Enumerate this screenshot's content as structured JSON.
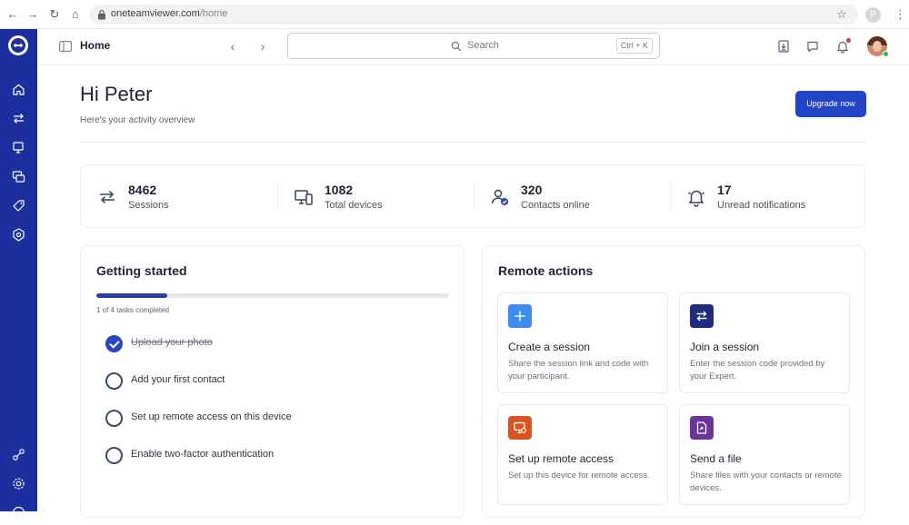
{
  "browser": {
    "url_host": "oneteamviewer.com",
    "url_path": "/home",
    "profile_initial": "P"
  },
  "header": {
    "title": "Home",
    "search_placeholder": "Search",
    "search_shortcut": "Ctrl + K"
  },
  "main": {
    "greeting": "Hi Peter",
    "subtitle": "Here's your activity overview",
    "upgrade_label": "Upgrade now"
  },
  "stats": [
    {
      "value": "8462",
      "label": "Sessions",
      "icon": "arrows-exchange-icon"
    },
    {
      "value": "1082",
      "label": "Total devices",
      "icon": "devices-icon"
    },
    {
      "value": "320",
      "label": "Contacts online",
      "icon": "contact-check-icon"
    },
    {
      "value": "17",
      "label": "Unread notifications",
      "icon": "bell-icon"
    }
  ],
  "getting_started": {
    "title": "Getting started",
    "progress_fraction": 0.2,
    "progress_text": "1 of 4 tasks completed",
    "tasks": [
      {
        "label": "Upload your photo",
        "done": true
      },
      {
        "label": "Add your first contact",
        "done": false
      },
      {
        "label": "Set up remote access on this device",
        "done": false
      },
      {
        "label": "Enable two-factor authentication",
        "done": false
      }
    ]
  },
  "remote_actions": {
    "title": "Remote actions",
    "items": [
      {
        "title": "Create a session",
        "desc": "Share the session link and code with your participant.",
        "icon": "plus-icon",
        "color": "#3a8ef0"
      },
      {
        "title": "Join a session",
        "desc": "Enter the session code provided by your Expert.",
        "icon": "swap-arrows-icon",
        "color": "#1e2b7e"
      },
      {
        "title": "Set up remote access",
        "desc": "Set up this device for remote access.",
        "icon": "monitor-gear-icon",
        "color": "#d9541e"
      },
      {
        "title": "Send a file",
        "desc": "Share files with your contacts or remote devices.",
        "icon": "file-send-icon",
        "color": "#6a3597"
      }
    ]
  },
  "colors": {
    "sidebar": "#1d2f9e",
    "primary_button": "#2245c7",
    "progress": "#2b3fa8"
  }
}
